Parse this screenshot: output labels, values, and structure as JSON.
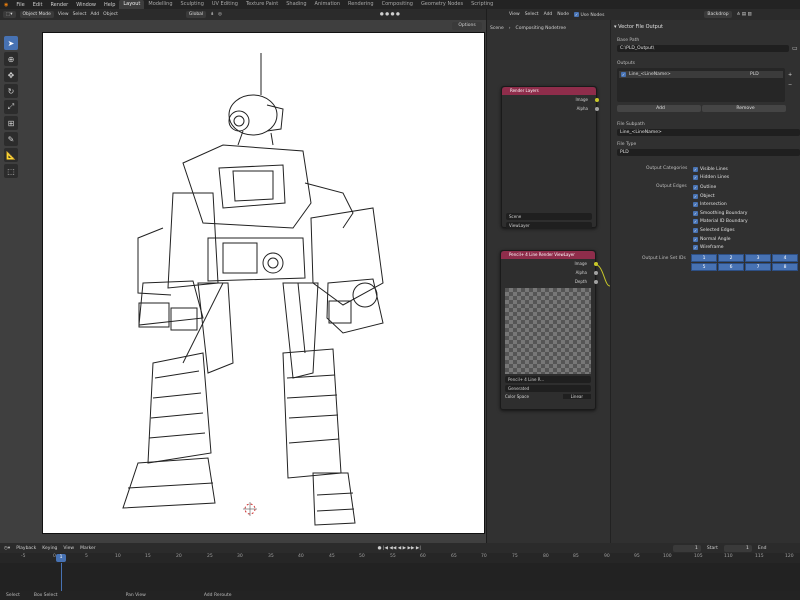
{
  "menu": [
    "File",
    "Edit",
    "Render",
    "Window",
    "Help"
  ],
  "workspaces": [
    {
      "label": "Layout",
      "active": true
    },
    {
      "label": "Modelling"
    },
    {
      "label": "Sculpting"
    },
    {
      "label": "UV Editing"
    },
    {
      "label": "Texture Paint"
    },
    {
      "label": "Shading"
    },
    {
      "label": "Animation"
    },
    {
      "label": "Rendering"
    },
    {
      "label": "Compositing"
    },
    {
      "label": "Geometry Nodes"
    },
    {
      "label": "Scripting"
    }
  ],
  "viewport": {
    "mode": "Object Mode",
    "menus": [
      "View",
      "Select",
      "Add",
      "Object"
    ],
    "orientation": "Global",
    "options_label": "Options"
  },
  "node_editor": {
    "menus": [
      "View",
      "Select",
      "Add",
      "Node"
    ],
    "use_nodes_label": "Use Nodes",
    "backdrop_label": "Backdrop",
    "breadcrumb": [
      "Scene",
      "Compositing Nodetree"
    ],
    "render_layers_node": {
      "title": "Render Layers",
      "outputs": [
        "Image",
        "Alpha"
      ],
      "scene": "Scene",
      "view_layer": "ViewLayer"
    },
    "lineart_node": {
      "title": "Pencil+ 4 Line Render ViewLayer",
      "outputs": [
        "Image",
        "Alpha",
        "Depth"
      ],
      "image_name": "Pencil+ 4 Line R...",
      "source": "Generated",
      "color_space_label": "Color Space",
      "color_space_value": "Linear"
    }
  },
  "properties": {
    "panel_title": "Vector File Output",
    "base_path_label": "Base Path",
    "base_path_value": "C:\\PLD_Output\\",
    "outputs_label": "Outputs",
    "output_item": "Line_<LineName>",
    "output_item_format": "PLD",
    "add_label": "Add",
    "remove_label": "Remove",
    "file_subpath_label": "File Subpath",
    "file_subpath_value": "Line_<LineName>",
    "file_type_label": "File Type",
    "file_type_value": "PLD",
    "output_categories_label": "Output Categories",
    "output_categories": [
      "Visible Lines",
      "Hidden Lines"
    ],
    "output_edges_label": "Output Edges",
    "output_edges": [
      "Outline",
      "Object",
      "Intersection",
      "Smoothing Boundary",
      "Material ID Boundary",
      "Selected Edges",
      "Normal Angle",
      "Wireframe"
    ],
    "line_set_ids_label": "Output Line Set IDs",
    "line_set_ids": [
      "1",
      "2",
      "3",
      "4",
      "5",
      "6",
      "7",
      "8"
    ]
  },
  "timeline": {
    "menus": [
      "Playback",
      "Keying",
      "View",
      "Marker"
    ],
    "current_frame": "1",
    "start_label": "Start",
    "start_value": "1",
    "end_label": "End",
    "ticks": [
      "-5",
      "0",
      "5",
      "10",
      "15",
      "20",
      "25",
      "30",
      "35",
      "40",
      "45",
      "50",
      "55",
      "60",
      "65",
      "70",
      "75",
      "80",
      "85",
      "90",
      "95",
      "100",
      "105",
      "110",
      "115",
      "120"
    ]
  },
  "status": [
    "Select",
    "Box Select",
    "Pan View",
    "Add Reroute"
  ]
}
